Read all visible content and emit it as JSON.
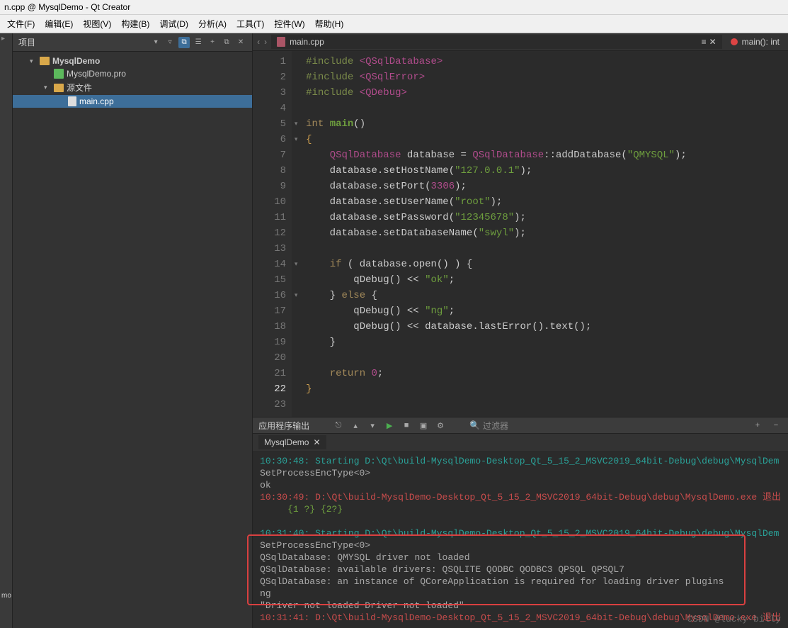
{
  "window": {
    "title": "n.cpp @ MysqlDemo - Qt Creator"
  },
  "menu": [
    "文件(F)",
    "编辑(E)",
    "视图(V)",
    "构建(B)",
    "调试(D)",
    "分析(A)",
    "工具(T)",
    "控件(W)",
    "帮助(H)"
  ],
  "project_panel": {
    "title": "项目",
    "icons": {
      "filter": "▾",
      "funnel": "▿",
      "link": "⧉",
      "tree": "☰",
      "plus": "+",
      "split": "⧉",
      "close": "✕"
    }
  },
  "tree": {
    "root": {
      "arrow": "▾",
      "label": "MysqlDemo"
    },
    "pro": {
      "label": "MysqlDemo.pro"
    },
    "src_folder": {
      "arrow": "▾",
      "label": "源文件"
    },
    "main": {
      "label": "main.cpp"
    }
  },
  "editor": {
    "file_tab": "main.cpp",
    "symbol": "main(): int",
    "nav": {
      "back": "‹",
      "fwd": "›"
    },
    "tab_actions": {
      "menu": "≡",
      "close": "✕"
    }
  },
  "code_lines": [
    [
      {
        "c": "pp",
        "t": "#include "
      },
      {
        "c": "inc",
        "t": "<QSqlDatabase>"
      }
    ],
    [
      {
        "c": "pp",
        "t": "#include "
      },
      {
        "c": "inc",
        "t": "<QSqlError>"
      }
    ],
    [
      {
        "c": "pp",
        "t": "#include "
      },
      {
        "c": "inc",
        "t": "<QDebug>"
      }
    ],
    [
      {
        "c": "",
        "t": ""
      }
    ],
    [
      {
        "c": "kw",
        "t": "int "
      },
      {
        "c": "func",
        "t": "main"
      },
      {
        "c": "op",
        "t": "()"
      }
    ],
    [
      {
        "c": "brace",
        "t": "{"
      }
    ],
    [
      {
        "c": "",
        "t": "    "
      },
      {
        "c": "type",
        "t": "QSqlDatabase"
      },
      {
        "c": "",
        "t": " database = "
      },
      {
        "c": "type",
        "t": "QSqlDatabase"
      },
      {
        "c": "op",
        "t": "::"
      },
      {
        "c": "",
        "t": "addDatabase("
      },
      {
        "c": "str",
        "t": "\"QMYSQL\""
      },
      {
        "c": "",
        "t": ");"
      }
    ],
    [
      {
        "c": "",
        "t": "    database.setHostName("
      },
      {
        "c": "str",
        "t": "\"127.0.0.1\""
      },
      {
        "c": "",
        "t": ");"
      }
    ],
    [
      {
        "c": "",
        "t": "    database.setPort("
      },
      {
        "c": "num",
        "t": "3306"
      },
      {
        "c": "",
        "t": ");"
      }
    ],
    [
      {
        "c": "",
        "t": "    database.setUserName("
      },
      {
        "c": "str",
        "t": "\"root\""
      },
      {
        "c": "",
        "t": ");"
      }
    ],
    [
      {
        "c": "",
        "t": "    database.setPassword("
      },
      {
        "c": "str",
        "t": "\"12345678\""
      },
      {
        "c": "",
        "t": ");"
      }
    ],
    [
      {
        "c": "",
        "t": "    database.setDatabaseName("
      },
      {
        "c": "str",
        "t": "\"swyl\""
      },
      {
        "c": "",
        "t": ");"
      }
    ],
    [
      {
        "c": "",
        "t": ""
      }
    ],
    [
      {
        "c": "",
        "t": "    "
      },
      {
        "c": "kw",
        "t": "if"
      },
      {
        "c": "",
        "t": " ( database.open() ) {"
      }
    ],
    [
      {
        "c": "",
        "t": "        qDebug() << "
      },
      {
        "c": "str",
        "t": "\"ok\""
      },
      {
        "c": "",
        "t": ";"
      }
    ],
    [
      {
        "c": "",
        "t": "    } "
      },
      {
        "c": "kw",
        "t": "else"
      },
      {
        "c": "",
        "t": " {"
      }
    ],
    [
      {
        "c": "",
        "t": "        qDebug() << "
      },
      {
        "c": "str",
        "t": "\"ng\""
      },
      {
        "c": "",
        "t": ";"
      }
    ],
    [
      {
        "c": "",
        "t": "        qDebug() << database.lastError().text();"
      }
    ],
    [
      {
        "c": "",
        "t": "    }"
      }
    ],
    [
      {
        "c": "",
        "t": ""
      }
    ],
    [
      {
        "c": "",
        "t": "    "
      },
      {
        "c": "kw",
        "t": "return"
      },
      {
        "c": "",
        "t": " "
      },
      {
        "c": "num",
        "t": "0"
      },
      {
        "c": "",
        "t": ";"
      }
    ],
    [
      {
        "c": "brace",
        "t": "}"
      }
    ],
    [
      {
        "c": "",
        "t": ""
      }
    ]
  ],
  "fold_marks": {
    "5": "▾",
    "6": "▾",
    "14": "▾",
    "16": "▾"
  },
  "current_line": 22,
  "output": {
    "title": "应用程序输出",
    "tab": "MysqlDemo",
    "tab_close": "✕",
    "search_placeholder": "过滤器",
    "search_icon": "🔍",
    "plus": "+",
    "minus": "−",
    "toolbar": {
      "target": "⎋",
      "up": "▴",
      "down": "▾",
      "run": "▶",
      "stop": "■",
      "attach": "▣",
      "gear": "⚙"
    }
  },
  "output_lines": [
    {
      "cls": "out-cyan",
      "t": "10:30:48: Starting D:\\Qt\\build-MysqlDemo-Desktop_Qt_5_15_2_MSVC2019_64bit-Debug\\debug\\MysqlDem"
    },
    {
      "cls": "",
      "t": "SetProcessEncType<0>"
    },
    {
      "cls": "",
      "t": "ok"
    },
    {
      "cls": "out-red",
      "t": "10:30:49: D:\\Qt\\build-MysqlDemo-Desktop_Qt_5_15_2_MSVC2019_64bit-Debug\\debug\\MysqlDemo.exe 退出"
    },
    {
      "cls": "out-green",
      "t": "     {1 ?} {2?}"
    },
    {
      "cls": "",
      "t": ""
    },
    {
      "cls": "out-cyan",
      "t": "10:31:40: Starting D:\\Qt\\build-MysqlDemo-Desktop_Qt_5_15_2_MSVC2019_64bit-Debug\\debug\\MysqlDem"
    },
    {
      "cls": "",
      "t": "SetProcessEncType<0>"
    },
    {
      "cls": "",
      "t": "QSqlDatabase: QMYSQL driver not loaded"
    },
    {
      "cls": "",
      "t": "QSqlDatabase: available drivers: QSQLITE QODBC QODBC3 QPSQL QPSQL7"
    },
    {
      "cls": "",
      "t": "QSqlDatabase: an instance of QCoreApplication is required for loading driver plugins"
    },
    {
      "cls": "",
      "t": "ng"
    },
    {
      "cls": "",
      "t": "\"Driver not loaded Driver not loaded\""
    },
    {
      "cls": "out-red",
      "t": "10:31:41: D:\\Qt\\build-MysqlDemo-Desktop_Qt_5_15_2_MSVC2019_64bit-Debug\\debug\\MysqlDemo.exe 退出"
    }
  ],
  "watermark": "CSDN @lucky-billy",
  "leftbar": "mo"
}
